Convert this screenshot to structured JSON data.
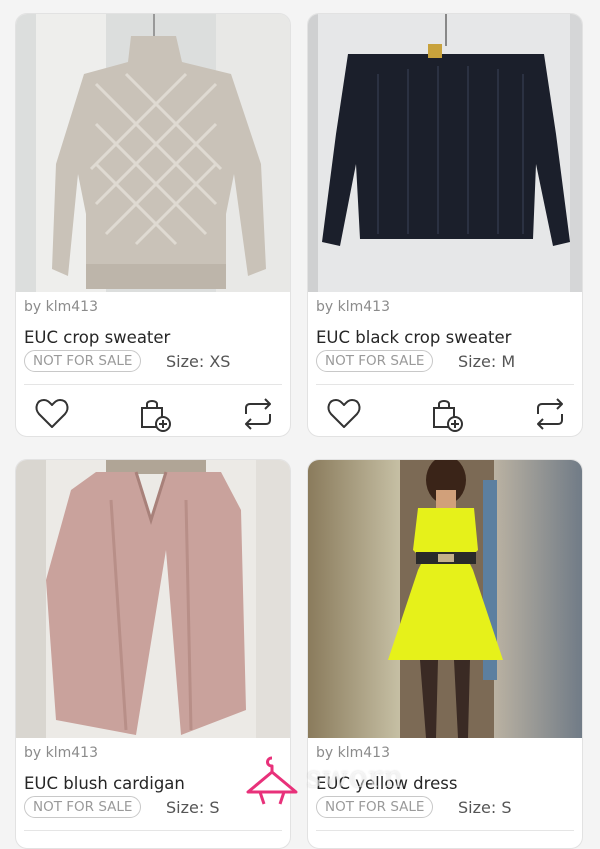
{
  "listings": [
    {
      "seller": "by klm413",
      "title": "EUC crop sweater",
      "badge": "NOT FOR SALE",
      "size": "Size: XS"
    },
    {
      "seller": "by klm413",
      "title": "EUC black crop sweater",
      "badge": "NOT FOR SALE",
      "size": "Size: M"
    },
    {
      "seller": "by klm413",
      "title": "EUC blush cardigan",
      "badge": "NOT FOR SALE",
      "size": "Size: S"
    },
    {
      "seller": "by klm413",
      "title": "EUC yellow dress",
      "badge": "NOT FOR SALE",
      "size": "Size: S"
    }
  ],
  "icons": {
    "like": "heart-icon",
    "add": "bag-plus-icon",
    "trade": "swap-arrows-icon"
  },
  "watermark": {
    "text": "sworn",
    "icon": "hanger-icon"
  },
  "colors": {
    "accent": "#e8317a",
    "muted_text": "#8b8b8b",
    "title_text": "#262626"
  }
}
